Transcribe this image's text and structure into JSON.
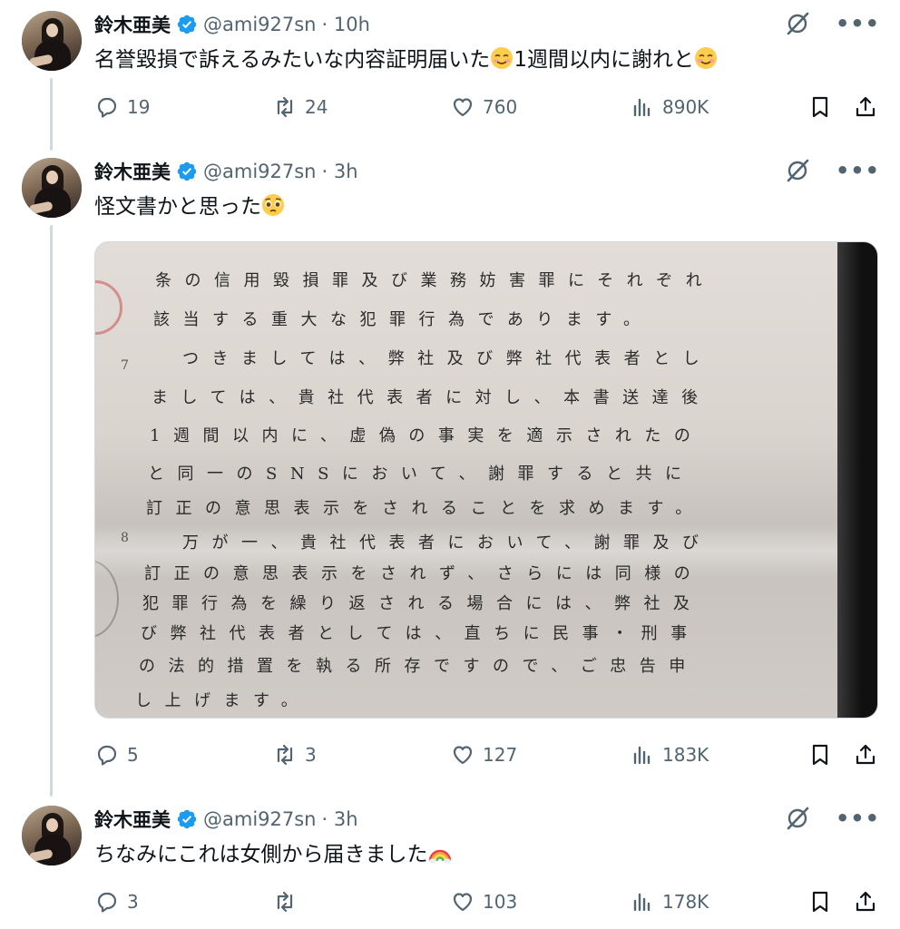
{
  "user": {
    "name": "鈴木亜美",
    "handle": "@ami927sn"
  },
  "tweets": [
    {
      "time": "· 10h",
      "text_before": "名誉毀損で訴えるみたいな内容証明届いた",
      "text_middle": "1週間以内に謝れと",
      "emoji": "smiling-face-emoji",
      "replies": "19",
      "retweets": "24",
      "likes": "760",
      "views": "890K"
    },
    {
      "time": "· 3h",
      "text_before": "怪文書かと思った",
      "emoji": "pleading-face-emoji",
      "replies": "5",
      "retweets": "3",
      "likes": "127",
      "views": "183K"
    },
    {
      "time": "· 3h",
      "text_before": "ちなみにこれは女側から届きました",
      "emoji": "rainbow-emoji",
      "replies": "3",
      "retweets": "",
      "likes": "103",
      "views": "178K"
    }
  ],
  "document": {
    "lines": [
      "条の信用毀損罪及び業務妨害罪にそれぞれ",
      "該当する重大な犯罪行為であります。",
      "つきましては、弊社及び弊社代表者とし",
      "ましては、貴社代表者に対し、本書送達後",
      "1週間以内に、虚偽の事実を適示されたの",
      "と同一のSNSにおいて、謝罪すると共に",
      "訂正の意思表示をされることを求めます。",
      "万が一、貴社代表者において、謝罪及び",
      "訂正の意思表示をされず、さらには同様の",
      "犯罪行為を繰り返される場合には、弊社及",
      "び弊社代表者としては、直ちに民事・刑事",
      "の法的措置を執る所存ですので、ご忠告申",
      "し上げます。"
    ],
    "line_numbers": [
      "7",
      "8"
    ]
  },
  "colors": {
    "text": "#0f1419",
    "secondary": "#536471",
    "verified": "#1d9bf0",
    "thread_line": "#cfd9de"
  }
}
